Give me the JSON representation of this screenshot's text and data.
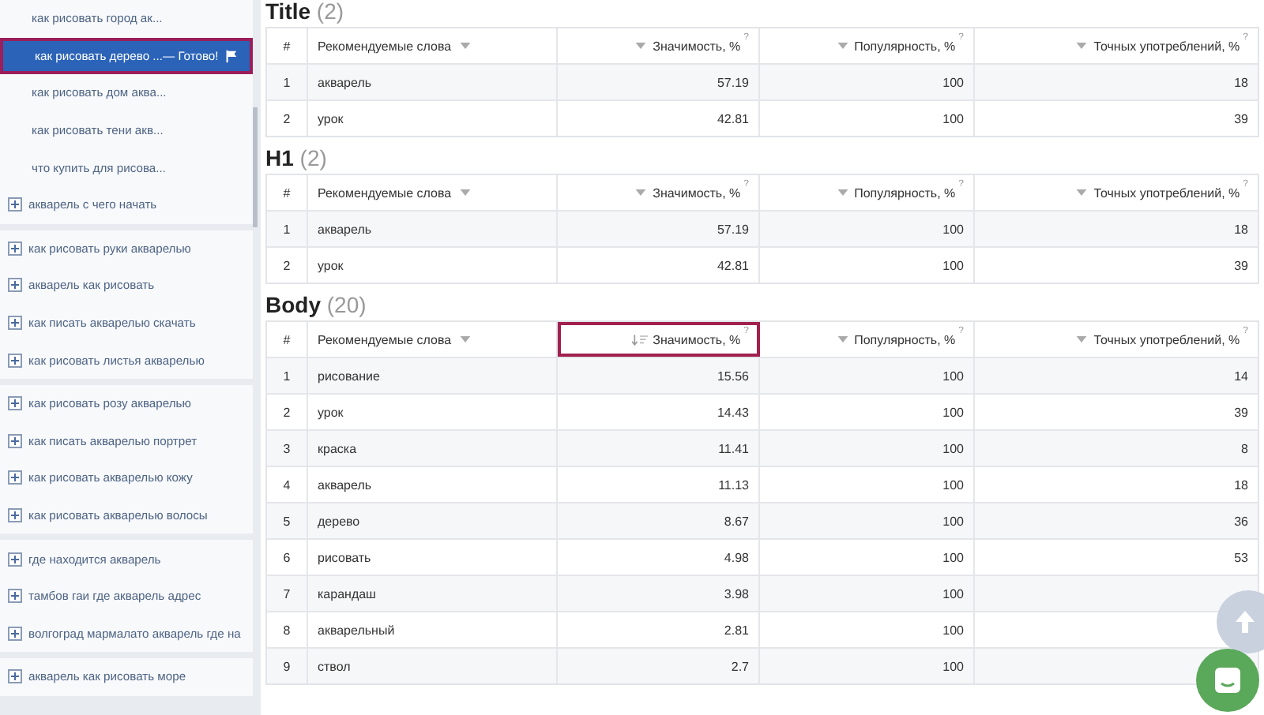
{
  "sidebar": {
    "sections": [
      {
        "items": [
          {
            "kind": "child",
            "label": "как рисовать город ак...",
            "selected": false
          },
          {
            "kind": "child",
            "label": "как рисовать дерево ...",
            "status": "— Готово!",
            "selected": true
          },
          {
            "kind": "child",
            "label": "как рисовать дом аква...",
            "selected": false
          },
          {
            "kind": "child",
            "label": "как рисовать тени акв...",
            "selected": false
          },
          {
            "kind": "child",
            "label": "что купить для рисова...",
            "selected": false
          },
          {
            "kind": "group",
            "label": "акварель с чего начать",
            "selected": false
          }
        ]
      },
      {
        "items": [
          {
            "kind": "group",
            "label": "как рисовать руки акварелью",
            "selected": false
          },
          {
            "kind": "group",
            "label": "акварель как рисовать",
            "selected": false
          },
          {
            "kind": "group",
            "label": "как писать акварелью скачать",
            "selected": false
          },
          {
            "kind": "group",
            "label": "как рисовать листья акварелью",
            "selected": false
          }
        ]
      },
      {
        "items": [
          {
            "kind": "group",
            "label": "как рисовать розу акварелью",
            "selected": false
          },
          {
            "kind": "group",
            "label": "как писать акварелью портрет",
            "selected": false
          },
          {
            "kind": "group",
            "label": "как рисовать акварелью кожу",
            "selected": false
          },
          {
            "kind": "group",
            "label": "как рисовать акварелью волосы",
            "selected": false
          }
        ]
      },
      {
        "items": [
          {
            "kind": "group",
            "label": "где находится акварель",
            "selected": false
          },
          {
            "kind": "group",
            "label": "тамбов гаи где акварель адрес",
            "selected": false
          },
          {
            "kind": "group",
            "label": "волгоград мармалато акварель где на",
            "selected": false
          }
        ]
      },
      {
        "items": [
          {
            "kind": "group",
            "label": "акварель как рисовать море",
            "selected": false
          }
        ]
      }
    ]
  },
  "tables": [
    {
      "title": "Title",
      "count": "(2)",
      "columns": [
        {
          "label": "#"
        },
        {
          "label": "Рекомендуемые слова",
          "sorted": false
        },
        {
          "label": "Значимость, %",
          "hint": "?",
          "sorted": false
        },
        {
          "label": "Популярность, %",
          "hint": "?",
          "sorted": false
        },
        {
          "label": "Точных употреблений, %",
          "hint": "?",
          "sorted": false
        }
      ],
      "rows": [
        [
          "1",
          "акварель",
          "57.19",
          "100",
          "18"
        ],
        [
          "2",
          "урок",
          "42.81",
          "100",
          "39"
        ]
      ]
    },
    {
      "title": "H1",
      "count": "(2)",
      "columns": [
        {
          "label": "#"
        },
        {
          "label": "Рекомендуемые слова",
          "sorted": false
        },
        {
          "label": "Значимость, %",
          "hint": "?",
          "sorted": false
        },
        {
          "label": "Популярность, %",
          "hint": "?",
          "sorted": false
        },
        {
          "label": "Точных употреблений, %",
          "hint": "?",
          "sorted": false
        }
      ],
      "rows": [
        [
          "1",
          "акварель",
          "57.19",
          "100",
          "18"
        ],
        [
          "2",
          "урок",
          "42.81",
          "100",
          "39"
        ]
      ]
    },
    {
      "title": "Body",
      "count": "(20)",
      "columns": [
        {
          "label": "#"
        },
        {
          "label": "Рекомендуемые слова",
          "sorted": false
        },
        {
          "label": "Значимость, %",
          "hint": "?",
          "sorted": true
        },
        {
          "label": "Популярность, %",
          "hint": "?",
          "sorted": false
        },
        {
          "label": "Точных употреблений, %",
          "hint": "?",
          "sorted": false
        }
      ],
      "rows": [
        [
          "1",
          "рисование",
          "15.56",
          "100",
          "14"
        ],
        [
          "2",
          "урок",
          "14.43",
          "100",
          "39"
        ],
        [
          "3",
          "краска",
          "11.41",
          "100",
          "8"
        ],
        [
          "4",
          "акварель",
          "11.13",
          "100",
          "18"
        ],
        [
          "5",
          "дерево",
          "8.67",
          "100",
          "36"
        ],
        [
          "6",
          "рисовать",
          "4.98",
          "100",
          "53"
        ],
        [
          "7",
          "карандаш",
          "3.98",
          "100"
        ],
        [
          "8",
          "акварельный",
          "2.81",
          "100"
        ],
        [
          "9",
          "ствол",
          "2.7",
          "100"
        ]
      ]
    }
  ]
}
